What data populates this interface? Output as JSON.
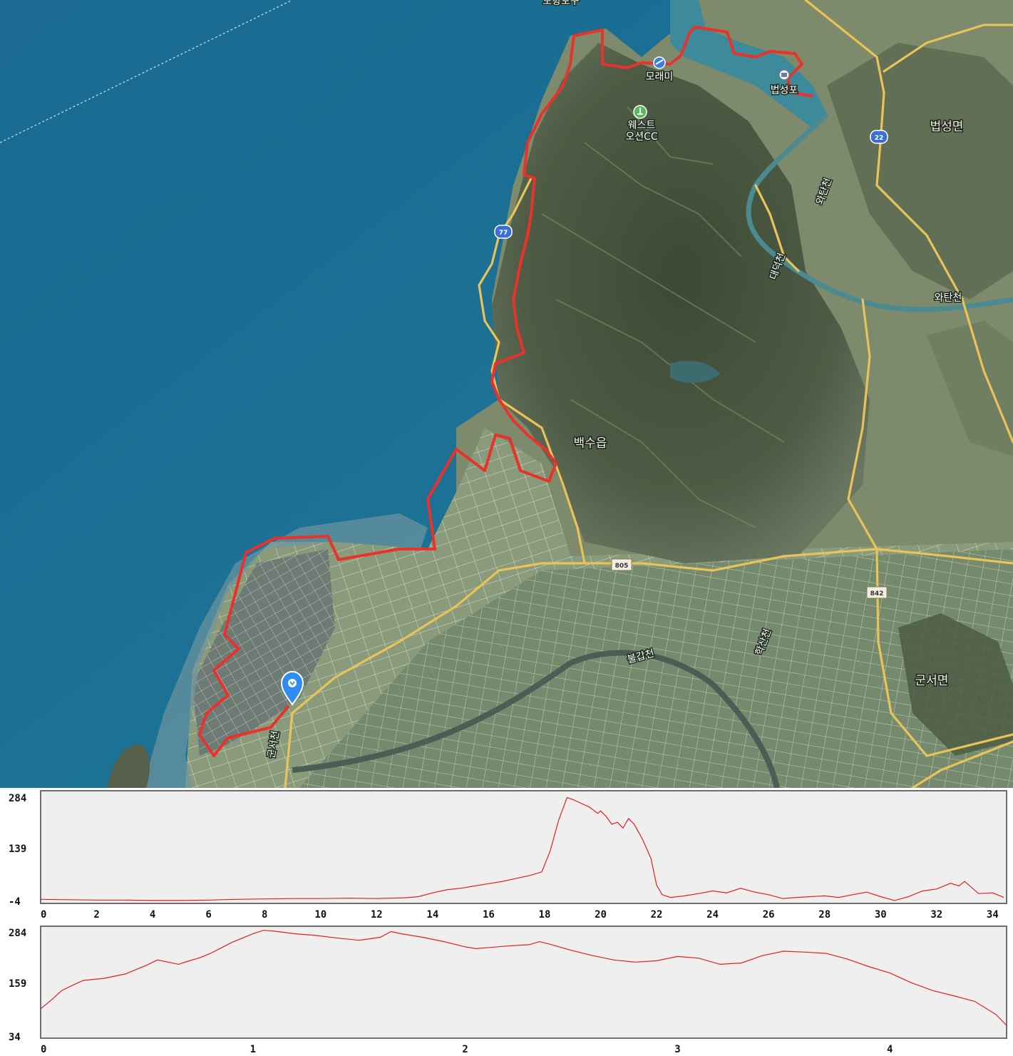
{
  "map": {
    "labels": {
      "top_cut": "모항포구",
      "moraemi": "모래미",
      "beopseongpo": "법성포",
      "west_ocean": "웨스트",
      "west_ocean_2": "오션CC",
      "beopseong_myeon": "법성면",
      "baeksu_eup": "백수읍",
      "gunseo_myeon": "군서면",
      "stream_wahtancheon": "와탄천",
      "stream_right": "와탄천",
      "stream_daeseok": "대덕천",
      "stream_bulgap": "불갑천",
      "stream_hakcheon": "학산천",
      "stream_gunseo": "군서천"
    },
    "road_shields": [
      {
        "number": "77",
        "kind": "national"
      },
      {
        "number": "22",
        "kind": "national"
      },
      {
        "number": "805",
        "kind": "provincial"
      },
      {
        "number": "842",
        "kind": "provincial"
      }
    ],
    "marker_icon": "location-pin-icon",
    "colors": {
      "sea": "#1f6f96",
      "track": "#e8322b",
      "road": "#e9c35a",
      "marker": "#2f8cf0"
    }
  },
  "chart_data": [
    {
      "type": "line",
      "name": "elevation-by-distance",
      "title": "",
      "xlabel": "",
      "ylabel": "",
      "y_tick_labels": [
        "284",
        "139",
        "-4"
      ],
      "x_tick_labels": [
        "0",
        "2",
        "4",
        "6",
        "8",
        "10",
        "12",
        "14",
        "16",
        "18",
        "20",
        "22",
        "24",
        "26",
        "28",
        "30",
        "32",
        "34"
      ],
      "xlim": [
        0,
        34.5
      ],
      "ylim": [
        -4,
        284
      ],
      "line_color": "#e02020",
      "x": [
        0,
        1,
        2,
        3,
        4,
        5,
        6,
        7,
        8,
        9,
        10,
        11,
        12,
        13,
        13.5,
        14,
        14.5,
        15,
        15.5,
        16,
        16.5,
        17,
        17.5,
        17.9,
        18.2,
        18.5,
        18.8,
        19,
        19.3,
        19.6,
        19.9,
        20,
        20.2,
        20.4,
        20.6,
        20.8,
        21,
        21.2,
        21.5,
        21.8,
        22,
        22.2,
        22.5,
        23,
        23.5,
        24,
        24.5,
        25,
        25.5,
        26,
        26.5,
        27,
        27.5,
        28,
        28.5,
        29,
        29.5,
        30,
        30.5,
        31,
        31.5,
        32,
        32.5,
        32.8,
        33,
        33.5,
        34,
        34.4
      ],
      "y": [
        3,
        2,
        1,
        1,
        0,
        0,
        1,
        3,
        4,
        5,
        5,
        6,
        5,
        7,
        10,
        20,
        28,
        32,
        38,
        44,
        50,
        58,
        66,
        75,
        130,
        210,
        270,
        265,
        255,
        245,
        228,
        235,
        220,
        200,
        205,
        190,
        215,
        200,
        160,
        110,
        40,
        15,
        8,
        12,
        18,
        25,
        20,
        32,
        22,
        15,
        5,
        8,
        10,
        12,
        8,
        15,
        22,
        10,
        0,
        10,
        25,
        30,
        45,
        38,
        50,
        18,
        20,
        8
      ]
    },
    {
      "type": "line",
      "name": "elevation-by-time",
      "title": "",
      "xlabel": "",
      "ylabel": "",
      "y_tick_labels": [
        "284",
        "159",
        "34"
      ],
      "x_tick_labels": [
        "0",
        "1",
        "2",
        "3",
        "4"
      ],
      "xlim": [
        0,
        4.55
      ],
      "ylim": [
        34,
        284
      ],
      "line_color": "#e02020",
      "x": [
        0,
        0.05,
        0.1,
        0.15,
        0.2,
        0.3,
        0.4,
        0.5,
        0.55,
        0.6,
        0.65,
        0.7,
        0.75,
        0.8,
        0.9,
        1.0,
        1.05,
        1.1,
        1.2,
        1.3,
        1.4,
        1.5,
        1.6,
        1.65,
        1.7,
        1.8,
        1.9,
        2.0,
        2.05,
        2.1,
        2.2,
        2.3,
        2.35,
        2.4,
        2.5,
        2.6,
        2.7,
        2.8,
        2.9,
        3.0,
        3.1,
        3.2,
        3.3,
        3.4,
        3.5,
        3.6,
        3.7,
        3.8,
        3.9,
        4.0,
        4.1,
        4.2,
        4.3,
        4.4,
        4.5,
        4.55
      ],
      "y": [
        98,
        118,
        140,
        152,
        163,
        168,
        178,
        198,
        210,
        205,
        200,
        208,
        215,
        225,
        250,
        270,
        278,
        276,
        270,
        266,
        260,
        255,
        262,
        275,
        270,
        262,
        252,
        240,
        236,
        238,
        242,
        245,
        252,
        246,
        232,
        220,
        210,
        205,
        208,
        218,
        214,
        200,
        203,
        220,
        230,
        228,
        225,
        212,
        195,
        180,
        158,
        140,
        128,
        115,
        85,
        60
      ]
    }
  ]
}
